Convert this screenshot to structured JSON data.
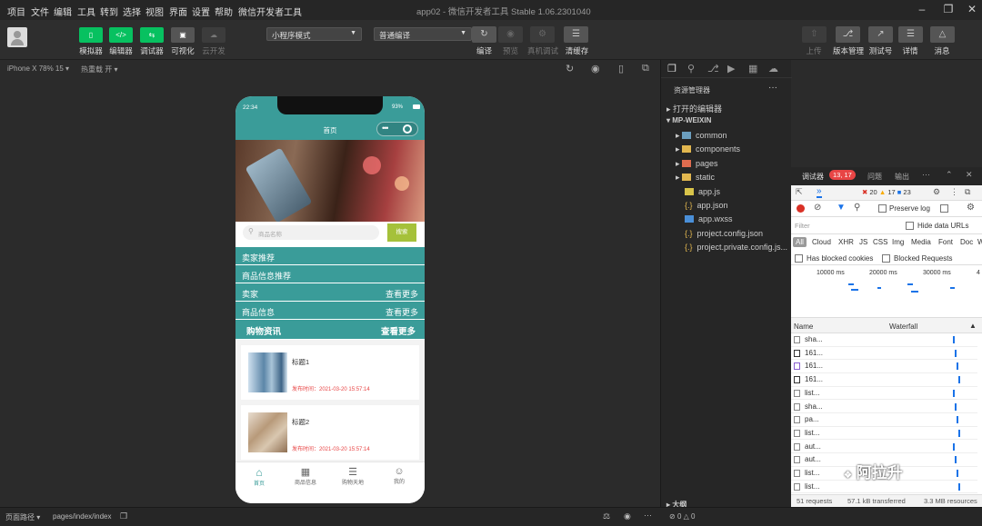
{
  "titlebar": {
    "menus": [
      "项目",
      "文件",
      "编辑",
      "工具",
      "转到",
      "选择",
      "视图",
      "界面",
      "设置",
      "帮助",
      "微信开发者工具"
    ],
    "title": "app02 - 微信开发者工具 Stable 1.06.2301040"
  },
  "toolbar": {
    "simulator": "模拟器",
    "editor": "编辑器",
    "debugger": "调试器",
    "visual": "可视化",
    "cloud": "云开发",
    "mode_select": "小程序模式",
    "compile_select": "普通编译",
    "compile": "编译",
    "preview": "预览",
    "real_debug": "真机调试",
    "clear_cache": "清缓存",
    "upload": "上传",
    "version": "版本管理",
    "test": "测试号",
    "details": "详情",
    "messages": "消息"
  },
  "simbar": {
    "device": "iPhone X 78% 15",
    "hotreload": "热重载 开"
  },
  "phone": {
    "time": "22:34",
    "battery": "93%",
    "nav_title": "首页",
    "search_placeholder": "商品名称",
    "search_button": "搜索",
    "sections": [
      "卖家推荐",
      "商品信息推荐"
    ],
    "rows": [
      {
        "left": "卖家",
        "right": "查看更多"
      },
      {
        "left": "商品信息",
        "right": "查看更多"
      },
      {
        "left": "购物资讯",
        "right": "查看更多"
      }
    ],
    "cards": [
      {
        "title": "标题1",
        "time": "发布时间：2021-03-20 15:57:14"
      },
      {
        "title": "标题2",
        "time": "发布时间：2021-03-20 15:57:14"
      }
    ],
    "tabs": [
      "首页",
      "商品信息",
      "购物天地",
      "我的"
    ]
  },
  "explorer": {
    "title": "资源管理器",
    "open_editors": "打开的编辑器",
    "root": "MP-WEIXIN",
    "items": [
      "common",
      "components",
      "pages",
      "static",
      "app.js",
      "app.json",
      "app.wxss",
      "project.config.json",
      "project.private.config.js..."
    ],
    "outline": "大纲"
  },
  "devtools": {
    "tab_debugger": "调试器",
    "badge": "13, 17",
    "tab_issues": "问题",
    "tab_output": "输出",
    "errors": "20",
    "warnings": "17",
    "infos": "23",
    "preserve_log": "Preserve log",
    "filter_placeholder": "Filter",
    "hide_data_urls": "Hide data URLs",
    "types": [
      "All",
      "Cloud",
      "XHR",
      "JS",
      "CSS",
      "Img",
      "Media",
      "Font",
      "Doc",
      "W"
    ],
    "blocked_cookies": "Has blocked cookies",
    "blocked_requests": "Blocked Requests",
    "timeline": [
      "10000 ms",
      "20000 ms",
      "30000 ms",
      "4"
    ],
    "col_name": "Name",
    "col_waterfall": "Waterfall",
    "requests": [
      "sha...",
      "161...",
      "161...",
      "161...",
      "list...",
      "sha...",
      "pa...",
      "list...",
      "aut...",
      "aut...",
      "list...",
      "list..."
    ],
    "footer_requests": "51 requests",
    "footer_transferred": "57.1 kB transferred",
    "footer_resources": "3.3 MB resources"
  },
  "bottom": {
    "path_label": "页面路径",
    "path": "pages/index/index",
    "errors": "0",
    "warnings": "0"
  },
  "watermark": "阿拉升",
  "colors": {
    "accent": "#3a9c99",
    "green": "#07c160",
    "search_btn": "#a5c13a",
    "error": "#e84545"
  }
}
